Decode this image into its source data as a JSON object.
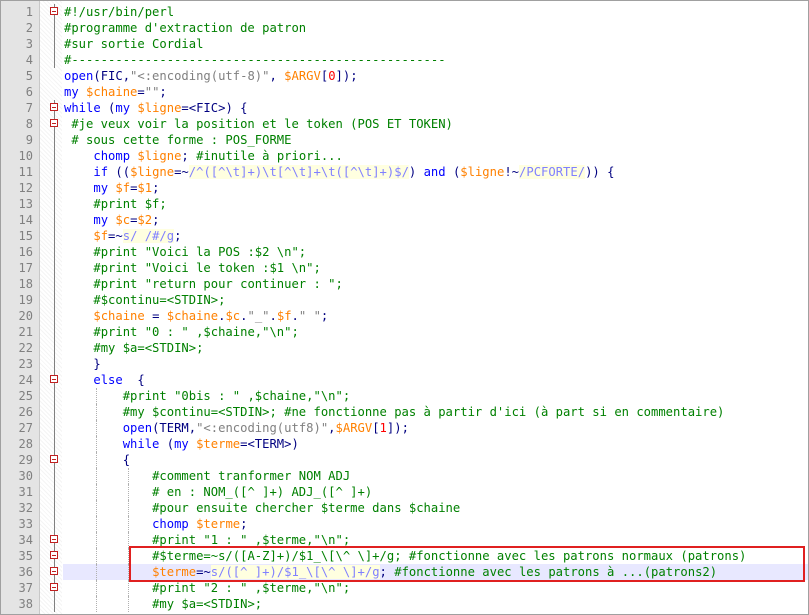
{
  "editor": {
    "current_line": 36,
    "annotation_color": "#e02020",
    "lines": [
      {
        "n": "1",
        "fold": "box",
        "guides": [],
        "t": [
          [
            "cmt",
            "#!/usr/bin/perl"
          ]
        ]
      },
      {
        "n": "2",
        "fold": "line",
        "guides": [],
        "t": [
          [
            "cmt",
            "#programme d'extraction de patron"
          ]
        ]
      },
      {
        "n": "3",
        "fold": "line",
        "guides": [],
        "t": [
          [
            "cmt",
            "#sur sortie Cordial"
          ]
        ]
      },
      {
        "n": "4",
        "fold": "line",
        "guides": [],
        "t": [
          [
            "cmt",
            "#---------------------------------------------------"
          ]
        ]
      },
      {
        "n": "5",
        "fold": "",
        "guides": [],
        "t": [
          [
            "kw",
            "open"
          ],
          [
            "op",
            "(FIC,"
          ],
          [
            "str",
            "\"<:encoding(utf-8)\""
          ],
          [
            "op",
            ", "
          ],
          [
            "var",
            "$ARGV"
          ],
          [
            "op",
            "["
          ],
          [
            "num",
            "0"
          ],
          [
            "op",
            "]);"
          ]
        ]
      },
      {
        "n": "6",
        "fold": "",
        "guides": [],
        "t": [
          [
            "kw",
            "my "
          ],
          [
            "var",
            "$chaine"
          ],
          [
            "op",
            "="
          ],
          [
            "str",
            "\"\""
          ],
          [
            "op",
            ";"
          ]
        ]
      },
      {
        "n": "7",
        "fold": "box",
        "guides": [],
        "t": [
          [
            "kw",
            "while "
          ],
          [
            "op",
            "("
          ],
          [
            "kw",
            "my "
          ],
          [
            "var",
            "$ligne"
          ],
          [
            "op",
            "=<FIC>) {"
          ]
        ]
      },
      {
        "n": "8",
        "fold": "box",
        "guides": [],
        "t": [
          [
            "cmt",
            " #je veux voir la position et le token (POS ET TOKEN)"
          ]
        ]
      },
      {
        "n": "9",
        "fold": "line",
        "guides": [],
        "t": [
          [
            "cmt",
            " # sous cette forme : POS_FORME"
          ]
        ]
      },
      {
        "n": "10",
        "fold": "line",
        "guides": [],
        "t": [
          [
            "op",
            "    "
          ],
          [
            "kw",
            "chomp "
          ],
          [
            "var",
            "$ligne"
          ],
          [
            "op",
            "; "
          ],
          [
            "cmt",
            "#inutile à priori..."
          ]
        ]
      },
      {
        "n": "11",
        "fold": "line",
        "guides": [],
        "t": [
          [
            "op",
            "    "
          ],
          [
            "kw",
            "if "
          ],
          [
            "op",
            "(("
          ],
          [
            "var",
            "$ligne"
          ],
          [
            "op",
            "=~"
          ],
          [
            "rx",
            "/^([^\\t]+)\\t[^\\t]+\\t([^\\t]+)$/"
          ],
          [
            "op",
            ") "
          ],
          [
            "kw",
            "and "
          ],
          [
            "op",
            "("
          ],
          [
            "var",
            "$ligne"
          ],
          [
            "op",
            "!~"
          ],
          [
            "rx",
            "/PCFORTE/"
          ],
          [
            "op",
            ")) {"
          ]
        ]
      },
      {
        "n": "12",
        "fold": "line",
        "guides": [],
        "t": [
          [
            "op",
            "    "
          ],
          [
            "kw",
            "my "
          ],
          [
            "var",
            "$f"
          ],
          [
            "op",
            "="
          ],
          [
            "var",
            "$1"
          ],
          [
            "op",
            ";"
          ]
        ]
      },
      {
        "n": "13",
        "fold": "line",
        "guides": [],
        "t": [
          [
            "op",
            "    "
          ],
          [
            "cmt",
            "#print $f;"
          ]
        ]
      },
      {
        "n": "14",
        "fold": "line",
        "guides": [],
        "t": [
          [
            "op",
            "    "
          ],
          [
            "kw",
            "my "
          ],
          [
            "var",
            "$c"
          ],
          [
            "op",
            "="
          ],
          [
            "var",
            "$2"
          ],
          [
            "op",
            ";"
          ]
        ]
      },
      {
        "n": "15",
        "fold": "line",
        "guides": [],
        "t": [
          [
            "op",
            "    "
          ],
          [
            "var",
            "$f"
          ],
          [
            "op",
            "=~"
          ],
          [
            "rx",
            "s/ /#/g"
          ],
          [
            "op",
            ";"
          ]
        ]
      },
      {
        "n": "16",
        "fold": "line",
        "guides": [],
        "t": [
          [
            "op",
            "    "
          ],
          [
            "cmt",
            "#print \"Voici la POS :$2 \\n\";"
          ]
        ]
      },
      {
        "n": "17",
        "fold": "line",
        "guides": [],
        "t": [
          [
            "op",
            "    "
          ],
          [
            "cmt",
            "#print \"Voici le token :$1 \\n\";"
          ]
        ]
      },
      {
        "n": "18",
        "fold": "line",
        "guides": [],
        "t": [
          [
            "op",
            "    "
          ],
          [
            "cmt",
            "#print \"return pour continuer : \";"
          ]
        ]
      },
      {
        "n": "19",
        "fold": "line",
        "guides": [],
        "t": [
          [
            "op",
            "    "
          ],
          [
            "cmt",
            "#$continu=<STDIN>;"
          ]
        ]
      },
      {
        "n": "20",
        "fold": "line",
        "guides": [],
        "t": [
          [
            "op",
            "    "
          ],
          [
            "var",
            "$chaine"
          ],
          [
            "op",
            " = "
          ],
          [
            "var",
            "$chaine"
          ],
          [
            "op",
            "."
          ],
          [
            "var",
            "$c"
          ],
          [
            "op",
            "."
          ],
          [
            "str",
            "\"_\""
          ],
          [
            "op",
            "."
          ],
          [
            "var",
            "$f"
          ],
          [
            "op",
            "."
          ],
          [
            "str",
            "\" \""
          ],
          [
            "op",
            ";"
          ]
        ]
      },
      {
        "n": "21",
        "fold": "line",
        "guides": [],
        "t": [
          [
            "op",
            "    "
          ],
          [
            "cmt",
            "#print \"0 : \" ,$chaine,\"\\n\";"
          ]
        ]
      },
      {
        "n": "22",
        "fold": "line",
        "guides": [],
        "t": [
          [
            "op",
            "    "
          ],
          [
            "cmt",
            "#my $a=<STDIN>;"
          ]
        ]
      },
      {
        "n": "23",
        "fold": "line",
        "guides": [],
        "t": [
          [
            "op",
            "    }"
          ]
        ]
      },
      {
        "n": "24",
        "fold": "box",
        "guides": [],
        "t": [
          [
            "op",
            "    "
          ],
          [
            "kw",
            "else "
          ],
          [
            "op",
            " {"
          ]
        ]
      },
      {
        "n": "25",
        "fold": "line",
        "guides": [
          95
        ],
        "t": [
          [
            "op",
            "        "
          ],
          [
            "cmt",
            "#print \"0bis : \" ,$chaine,\"\\n\";"
          ]
        ]
      },
      {
        "n": "26",
        "fold": "line",
        "guides": [
          95
        ],
        "t": [
          [
            "op",
            "        "
          ],
          [
            "cmt",
            "#my $continu=<STDIN>; #ne fonctionne pas à partir d'ici (à part si en commentaire)"
          ]
        ]
      },
      {
        "n": "27",
        "fold": "line",
        "guides": [
          95
        ],
        "t": [
          [
            "op",
            "        "
          ],
          [
            "kw",
            "open"
          ],
          [
            "op",
            "(TERM,"
          ],
          [
            "str",
            "\"<:encoding(utf8)\""
          ],
          [
            "op",
            ","
          ],
          [
            "var",
            "$ARGV"
          ],
          [
            "op",
            "["
          ],
          [
            "num",
            "1"
          ],
          [
            "op",
            "]);"
          ]
        ]
      },
      {
        "n": "28",
        "fold": "line",
        "guides": [
          95
        ],
        "t": [
          [
            "op",
            "        "
          ],
          [
            "kw",
            "while "
          ],
          [
            "op",
            "("
          ],
          [
            "kw",
            "my "
          ],
          [
            "var",
            "$terme"
          ],
          [
            "op",
            "=<TERM>)"
          ]
        ]
      },
      {
        "n": "29",
        "fold": "box",
        "guides": [
          95
        ],
        "t": [
          [
            "op",
            "        {"
          ]
        ]
      },
      {
        "n": "30",
        "fold": "line",
        "guides": [
          95,
          127
        ],
        "t": [
          [
            "op",
            "            "
          ],
          [
            "cmt",
            "#comment tranformer NOM ADJ"
          ]
        ]
      },
      {
        "n": "31",
        "fold": "line",
        "guides": [
          95,
          127
        ],
        "t": [
          [
            "op",
            "            "
          ],
          [
            "cmt",
            "# en : NOM_([^ ]+) ADJ_([^ ]+)"
          ]
        ]
      },
      {
        "n": "32",
        "fold": "line",
        "guides": [
          95,
          127
        ],
        "t": [
          [
            "op",
            "            "
          ],
          [
            "cmt",
            "#pour ensuite chercher $terme dans $chaine"
          ]
        ]
      },
      {
        "n": "33",
        "fold": "line",
        "guides": [
          95,
          127
        ],
        "t": [
          [
            "op",
            "            "
          ],
          [
            "kw",
            "chomp "
          ],
          [
            "var",
            "$terme"
          ],
          [
            "op",
            ";"
          ]
        ]
      },
      {
        "n": "34",
        "fold": "box",
        "guides": [
          95,
          127
        ],
        "t": [
          [
            "op",
            "            "
          ],
          [
            "cmt",
            "#print \"1 : \" ,$terme,\"\\n\";"
          ]
        ]
      },
      {
        "n": "35",
        "fold": "box",
        "guides": [
          95,
          127
        ],
        "t": [
          [
            "op",
            "            "
          ],
          [
            "cmt",
            "#$terme=~s/([A-Z]+)/$1_\\[\\^ \\]+/g; #fonctionne avec les patrons normaux (patrons)"
          ]
        ]
      },
      {
        "n": "36",
        "fold": "box",
        "guides": [
          95,
          127
        ],
        "t": [
          [
            "op",
            "            "
          ],
          [
            "var",
            "$terme"
          ],
          [
            "op",
            "=~"
          ],
          [
            "rx",
            "s/([^ ]+)/$1_\\[\\^ \\]+/g"
          ],
          [
            "op",
            "; "
          ],
          [
            "cmt",
            "#fonctionne avec les patrons à ...(patrons2)"
          ]
        ]
      },
      {
        "n": "37",
        "fold": "box",
        "guides": [
          95,
          127
        ],
        "t": [
          [
            "op",
            "            "
          ],
          [
            "cmt",
            "#print \"2 : \" ,$terme,\"\\n\";"
          ]
        ]
      },
      {
        "n": "38",
        "fold": "line",
        "guides": [
          95,
          127
        ],
        "t": [
          [
            "op",
            "            "
          ],
          [
            "cmt",
            "#my $a=<STDIN>;"
          ]
        ]
      }
    ]
  }
}
